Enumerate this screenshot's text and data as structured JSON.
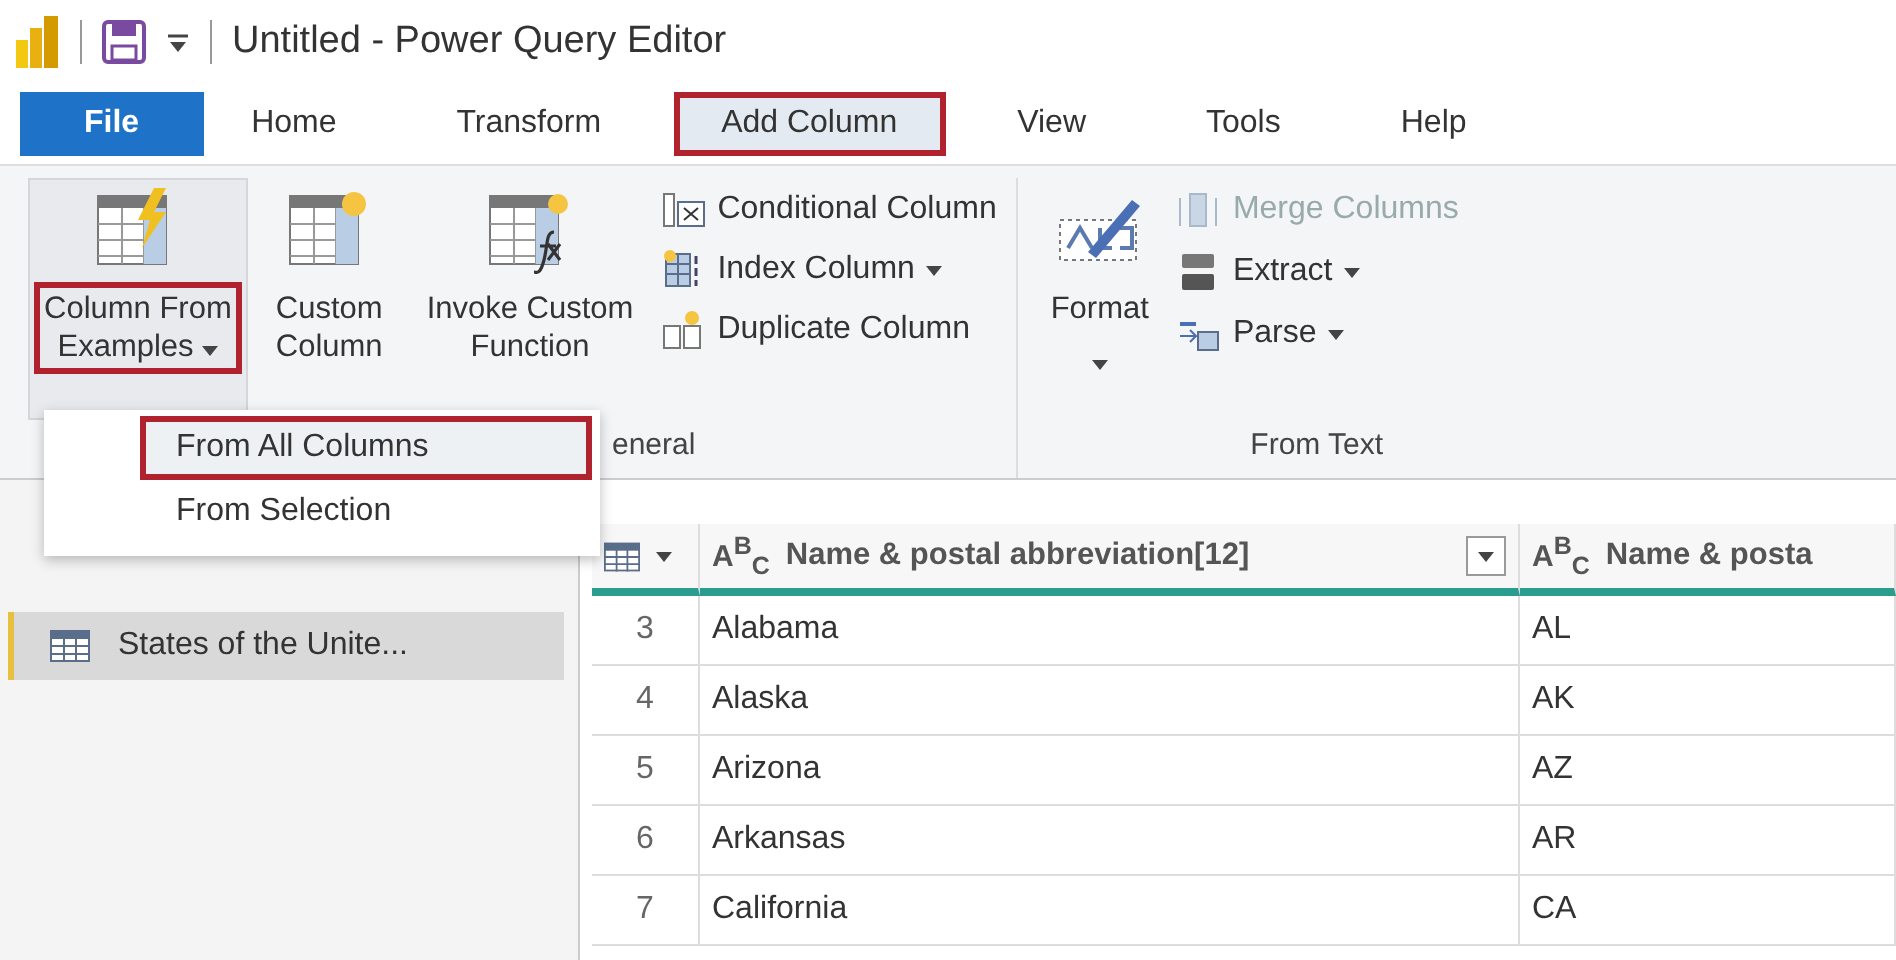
{
  "window": {
    "title": "Untitled - Power Query Editor"
  },
  "tabs": [
    {
      "label": "File",
      "kind": "file",
      "selected": false,
      "highlighted": false
    },
    {
      "label": "Home",
      "kind": "tab",
      "selected": false,
      "highlighted": false
    },
    {
      "label": "Transform",
      "kind": "tab",
      "selected": false,
      "highlighted": false
    },
    {
      "label": "Add Column",
      "kind": "tab",
      "selected": true,
      "highlighted": true
    },
    {
      "label": "View",
      "kind": "tab",
      "selected": false,
      "highlighted": false
    },
    {
      "label": "Tools",
      "kind": "tab",
      "selected": false,
      "highlighted": false
    },
    {
      "label": "Help",
      "kind": "tab",
      "selected": false,
      "highlighted": false
    }
  ],
  "ribbon": {
    "groups": [
      {
        "label": "eneral",
        "large": [
          {
            "lines": [
              "Column From",
              "Examples"
            ],
            "kind": "examples",
            "dropdown": true,
            "highlighted": true,
            "pressed": true
          },
          {
            "lines": [
              "Custom",
              "Column"
            ],
            "kind": "custom",
            "dropdown": false,
            "highlighted": false,
            "pressed": false
          },
          {
            "lines": [
              "Invoke Custom",
              "Function"
            ],
            "kind": "function",
            "dropdown": false,
            "highlighted": false,
            "pressed": false
          }
        ],
        "small": [
          {
            "label": "Conditional Column",
            "kind": "conditional",
            "dropdown": false,
            "disabled": false
          },
          {
            "label": "Index Column",
            "kind": "index",
            "dropdown": true,
            "disabled": false
          },
          {
            "label": "Duplicate Column",
            "kind": "duplicate",
            "dropdown": false,
            "disabled": false
          }
        ]
      },
      {
        "label": "From Text",
        "large": [
          {
            "lines": [
              "Format"
            ],
            "kind": "format",
            "dropdown": true,
            "highlighted": false,
            "pressed": false
          }
        ],
        "small": [
          {
            "label": "Merge Columns",
            "kind": "merge",
            "dropdown": false,
            "disabled": true
          },
          {
            "label": "Extract",
            "kind": "extract",
            "dropdown": true,
            "disabled": false
          },
          {
            "label": "Parse",
            "kind": "parse",
            "dropdown": true,
            "disabled": false
          }
        ]
      }
    ]
  },
  "menu": {
    "items": [
      {
        "label": "From All Columns",
        "selected": true,
        "highlighted": true
      },
      {
        "label": "From Selection",
        "selected": false,
        "highlighted": false
      }
    ]
  },
  "queries": [
    {
      "label": "States of the Unite...",
      "selected": true
    }
  ],
  "table": {
    "columns": [
      {
        "type": "A$^{B}$$_{C}$",
        "label": "Name & postal abbreviation[12]",
        "filter": true
      },
      {
        "type": "A$^{B}$$_{C}$",
        "label": "Name & posta",
        "filter": false
      }
    ],
    "rows": [
      {
        "number": "3",
        "cells": [
          "Alabama",
          "AL"
        ]
      },
      {
        "number": "4",
        "cells": [
          "Alaska",
          "AK"
        ]
      },
      {
        "number": "5",
        "cells": [
          "Arizona",
          "AZ"
        ]
      },
      {
        "number": "6",
        "cells": [
          "Arkansas",
          "AR"
        ]
      },
      {
        "number": "7",
        "cells": [
          "California",
          "CA"
        ]
      }
    ]
  }
}
